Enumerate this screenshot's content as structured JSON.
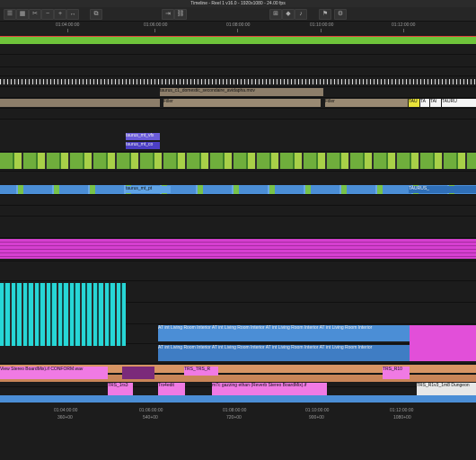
{
  "window": {
    "title": "Timeline - Reel 1 v16.0 - 1920x1080 - 24.00 fps"
  },
  "toolbar": {
    "icons": [
      "list-icon",
      "grid-icon",
      "clip-icon",
      "zoom-out-icon",
      "zoom-in-icon",
      "fit-icon",
      "split-icon",
      "trim-icon",
      "link-icon",
      "snap-icon",
      "marker-icon",
      "audio-icon",
      "flag-icon",
      "settings-icon"
    ]
  },
  "ruler_top": {
    "labels": [
      "01:04:00:00",
      "01:06:00:00",
      "01:08:00:00",
      "01:10:00:00",
      "01:12:00:00"
    ]
  },
  "ruler_bottom": {
    "timecodes": [
      "01:04:00:00",
      "01:06:00:00",
      "01:08:00:00",
      "01:10:00:00",
      "01:12:00:00"
    ],
    "frames": [
      "360+00",
      "540+00",
      "720+00",
      "900+00",
      "1080+00"
    ]
  },
  "clips": {
    "v_top_name": "taurus_c1_domestic_secondaire",
    "v_top_name2": "_avidapha.mov",
    "filler1": "Filler",
    "filler2": "Filler",
    "tau1": "TAU",
    "tau2": "TA",
    "tau3": "TAI",
    "tau4": "TAURU",
    "t_mt_1": "taurus_mt_vfx",
    "t_mt_2": "taurus_mt_co",
    "t_mt_3": "taurus_mt_pt",
    "taurus_right": "TAURUS_",
    "living1": "AT int Living Room Interior",
    "living2": "AT int Living Room Interior",
    "living3": "AT int Living Room Interior",
    "living4": "AT int Living Room Interior",
    "living5": "AT int Living Room Interior",
    "living6": "AT int Living Room Interior",
    "living7": "AT int Living Room Interior",
    "living8": "AT int Living Room Interior",
    "view_stereo": "View Stereo BoardMix).if CONFORM.wav",
    "trs1": "TRS_1rs3",
    "trs2": "TRS_",
    "trs3": "TRS_R",
    "trs4": "Trs4edit",
    "gazing": "m7c gazzing ethan (Reverb Stereo BoardMix).if",
    "trs_right": "TRS_R1v3_1m8 Dungeon",
    "trs_right2": "TRS_R10"
  },
  "colors": {
    "accent_green": "#6fc43a",
    "video_blue": "#4b8ed6",
    "audio_cyan": "#27d6d6",
    "audio_magenta": "#e24fd9",
    "filler_tan": "#9a8a73",
    "orange_band": "#d89564"
  }
}
